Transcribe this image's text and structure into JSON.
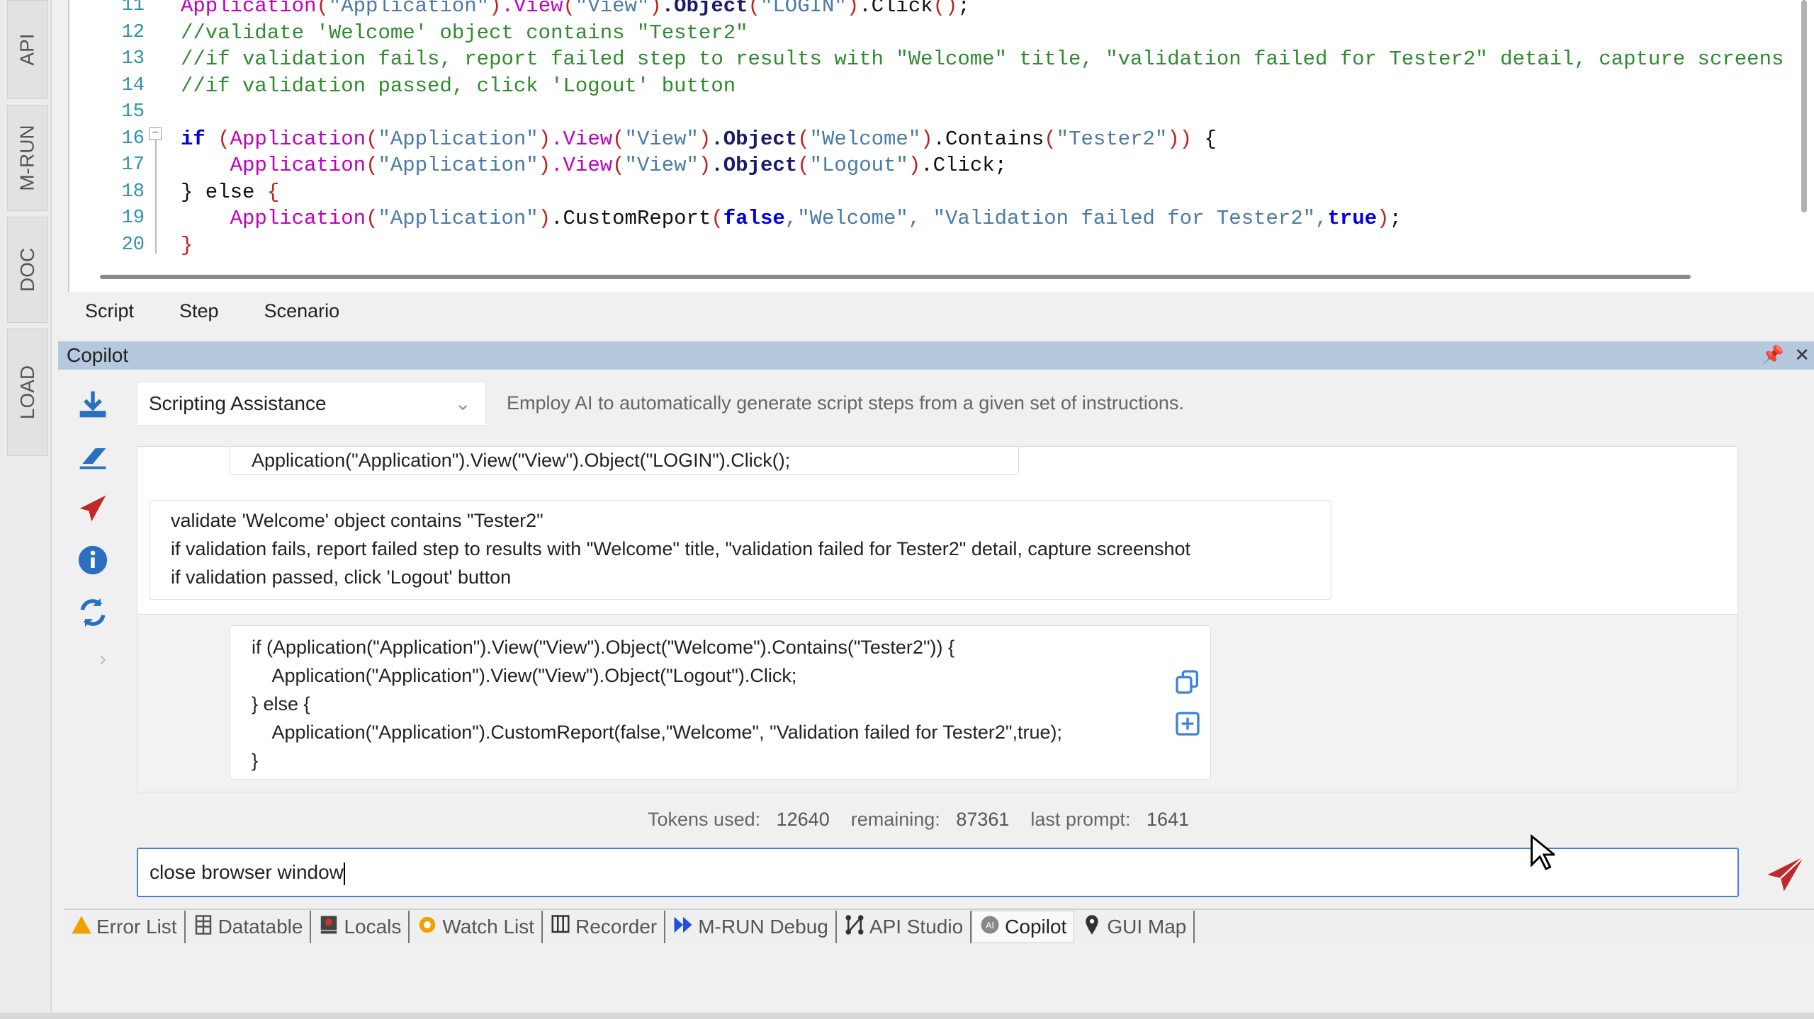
{
  "vertical_tabs": [
    "API",
    "M-RUN",
    "DOC",
    "LOAD"
  ],
  "editor": {
    "lines": [
      {
        "n": "11",
        "tokens": [
          [
            "fn",
            "Application"
          ],
          [
            "p",
            "("
          ],
          [
            "s",
            "\"Application\""
          ],
          [
            "p",
            ")"
          ],
          [
            "fn",
            ".View"
          ],
          [
            "p",
            "("
          ],
          [
            "s",
            "\"View\""
          ],
          [
            "p",
            ")"
          ],
          [
            "obj",
            ".Object"
          ],
          [
            "p",
            "("
          ],
          [
            "s",
            "\"LOGIN\""
          ],
          [
            "p",
            ")"
          ],
          [
            "x",
            ".Click"
          ],
          [
            "p",
            "()"
          ],
          [
            "x",
            ";"
          ]
        ]
      },
      {
        "n": "12",
        "tokens": [
          [
            "c",
            "//validate 'Welcome' object contains \"Tester2\""
          ]
        ]
      },
      {
        "n": "13",
        "tokens": [
          [
            "c",
            "//if validation fails, report failed step to results with \"Welcome\" title, \"validation failed for Tester2\" detail, capture screens"
          ]
        ]
      },
      {
        "n": "14",
        "tokens": [
          [
            "c",
            "//if validation passed, click 'Logout' button"
          ]
        ]
      },
      {
        "n": "15",
        "tokens": []
      },
      {
        "n": "16",
        "tokens": [
          [
            "k",
            "if"
          ],
          [
            "x",
            " "
          ],
          [
            "p",
            "("
          ],
          [
            "fn",
            "Application"
          ],
          [
            "p",
            "("
          ],
          [
            "s",
            "\"Application\""
          ],
          [
            "p",
            ")"
          ],
          [
            "fn",
            ".View"
          ],
          [
            "p",
            "("
          ],
          [
            "s",
            "\"View\""
          ],
          [
            "p",
            ")"
          ],
          [
            "obj",
            ".Object"
          ],
          [
            "p",
            "("
          ],
          [
            "s",
            "\"Welcome\""
          ],
          [
            "p",
            ")"
          ],
          [
            "x",
            ".Contains"
          ],
          [
            "p",
            "("
          ],
          [
            "s",
            "\"Tester2\""
          ],
          [
            "p",
            "))"
          ],
          [
            "x",
            " {"
          ]
        ]
      },
      {
        "n": "17",
        "tokens": [
          [
            "x",
            "    "
          ],
          [
            "fn",
            "Application"
          ],
          [
            "p",
            "("
          ],
          [
            "s",
            "\"Application\""
          ],
          [
            "p",
            ")"
          ],
          [
            "fn",
            ".View"
          ],
          [
            "p",
            "("
          ],
          [
            "s",
            "\"View\""
          ],
          [
            "p",
            ")"
          ],
          [
            "obj",
            ".Object"
          ],
          [
            "p",
            "("
          ],
          [
            "s",
            "\"Logout\""
          ],
          [
            "p",
            ")"
          ],
          [
            "x",
            ".Click;"
          ]
        ]
      },
      {
        "n": "18",
        "tokens": [
          [
            "x",
            "} else "
          ],
          [
            "p",
            "{"
          ]
        ]
      },
      {
        "n": "19",
        "tokens": [
          [
            "x",
            "    "
          ],
          [
            "fn",
            "Application"
          ],
          [
            "p",
            "("
          ],
          [
            "s",
            "\"Application\""
          ],
          [
            "p",
            ")"
          ],
          [
            "x",
            ".CustomReport"
          ],
          [
            "p",
            "("
          ],
          [
            "k",
            "false"
          ],
          [
            "s",
            ",\"Welcome\", \"Validation failed for Tester2\""
          ],
          [
            "s",
            ","
          ],
          [
            "k",
            "true"
          ],
          [
            "p",
            ")"
          ],
          [
            "x",
            ";"
          ]
        ]
      },
      {
        "n": "20",
        "tokens": [
          [
            "p",
            "}"
          ]
        ]
      }
    ]
  },
  "doc_tabs": [
    "Script",
    "Step",
    "Scenario"
  ],
  "copilot": {
    "title": "Copilot",
    "pin_icon": "pin-icon",
    "close_icon": "close-icon",
    "mode": "Scripting Assistance",
    "mode_description": "Employ AI to automatically generate script steps from a given set of instructions.",
    "messages": {
      "prev_code": "Application(\"Application\").View(\"View\").Object(\"LOGIN\").Click();",
      "user_prompt": "validate 'Welcome' object contains \"Tester2\"\nif validation fails, report failed step to results with \"Welcome\" title, \"validation failed for Tester2\" detail, capture screenshot\nif validation passed, click 'Logout' button",
      "response_code": "if (Application(\"Application\").View(\"View\").Object(\"Welcome\").Contains(\"Tester2\")) {\n    Application(\"Application\").View(\"View\").Object(\"Logout\").Click;\n} else {\n    Application(\"Application\").CustomReport(false,\"Welcome\", \"Validation failed for Tester2\",true);\n}"
    },
    "tokens": {
      "used_label": "Tokens used:",
      "used": "12640",
      "remaining_label": "remaining:",
      "remaining": "87361",
      "last_label": "last prompt:",
      "last": "1641"
    },
    "input_value": "close browser window"
  },
  "bottom_tabs": [
    {
      "label": "Error List",
      "icon": "warning-icon",
      "color": "#f0a000"
    },
    {
      "label": "Datatable",
      "icon": "table-icon",
      "color": "#555555"
    },
    {
      "label": "Locals",
      "icon": "locals-icon",
      "color": "#d03030"
    },
    {
      "label": "Watch List",
      "icon": "eye-icon",
      "color": "#f0a000"
    },
    {
      "label": "Recorder",
      "icon": "recorder-icon",
      "color": "#333333"
    },
    {
      "label": "M-RUN Debug",
      "icon": "fast-forward-icon",
      "color": "#2050e0"
    },
    {
      "label": "API Studio",
      "icon": "api-icon",
      "color": "#333333"
    },
    {
      "label": "Copilot",
      "icon": "ai-icon",
      "color": "#888888",
      "active": true
    },
    {
      "label": "GUI Map",
      "icon": "map-pin-icon",
      "color": "#333333"
    }
  ],
  "colors": {
    "accent": "#4a7fd8",
    "header": "#b6c8de",
    "send": "#c0282a"
  }
}
